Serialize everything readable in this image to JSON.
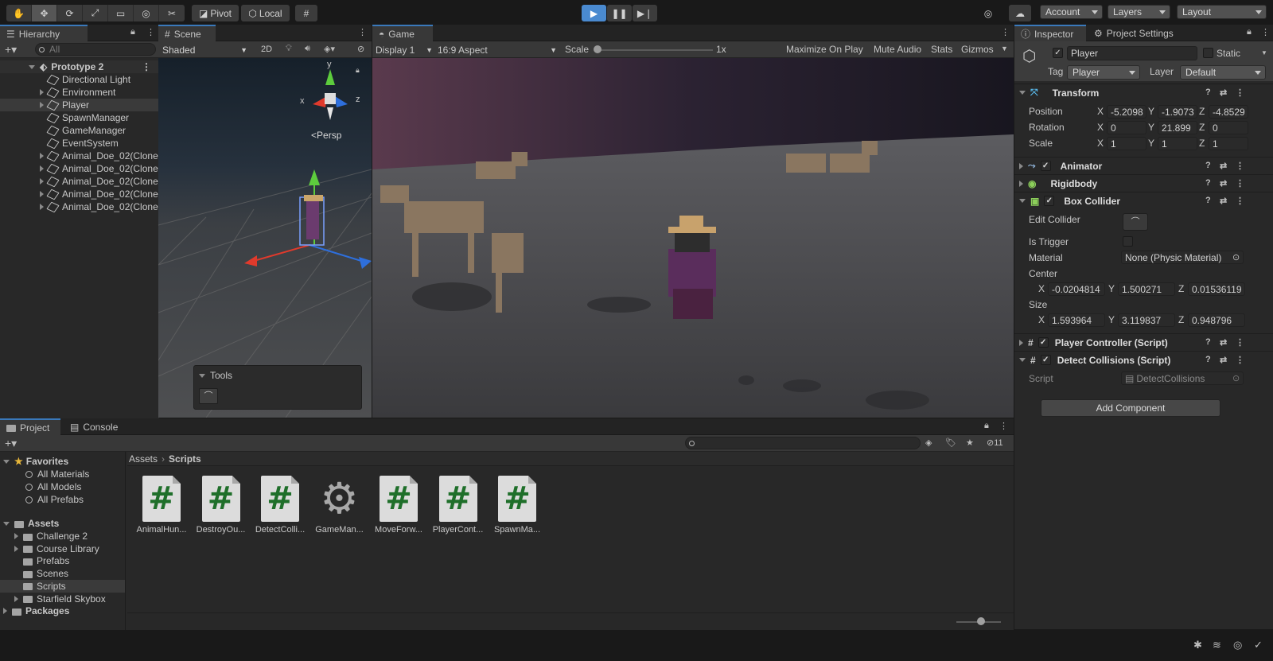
{
  "toolbar": {
    "pivot": "Pivot",
    "local": "Local",
    "account": "Account",
    "layers": "Layers",
    "layout": "Layout"
  },
  "hierarchy": {
    "tab": "Hierarchy",
    "search_placeholder": "All",
    "scene": "Prototype 2",
    "items": [
      "Directional Light",
      "Environment",
      "Player",
      "SpawnManager",
      "GameManager",
      "EventSystem",
      "Animal_Doe_02(Clone",
      "Animal_Doe_02(Clone",
      "Animal_Doe_02(Clone",
      "Animal_Doe_02(Clone",
      "Animal_Doe_02(Clone"
    ]
  },
  "scene": {
    "tab": "Scene",
    "shading": "Shaded",
    "mode_2d": "2D",
    "persp": "Persp",
    "gizmo_x": "x",
    "gizmo_y": "y",
    "gizmo_z": "z",
    "tools_title": "Tools"
  },
  "game": {
    "tab": "Game",
    "display": "Display 1",
    "aspect": "16:9 Aspect",
    "scale_label": "Scale",
    "scale_value": "1x",
    "maximize": "Maximize On Play",
    "mute": "Mute Audio",
    "stats": "Stats",
    "gizmos": "Gizmos"
  },
  "inspector": {
    "tab": "Inspector",
    "tab2": "Project Settings",
    "object_name": "Player",
    "static": "Static",
    "tag_label": "Tag",
    "tag_value": "Player",
    "layer_label": "Layer",
    "layer_value": "Default",
    "transform": {
      "title": "Transform",
      "position_label": "Position",
      "rotation_label": "Rotation",
      "scale_label": "Scale",
      "position": [
        "-5.2098",
        "-1.9073",
        "-4.8529"
      ],
      "rotation": [
        "0",
        "21.899",
        "0"
      ],
      "scale": [
        "1",
        "1",
        "1"
      ]
    },
    "axis": [
      "X",
      "Y",
      "Z"
    ],
    "animator": "Animator",
    "rigidbody": "Rigidbody",
    "box_collider": {
      "title": "Box Collider",
      "edit_collider": "Edit Collider",
      "is_trigger": "Is Trigger",
      "material_label": "Material",
      "material_value": "None (Physic Material)",
      "center_label": "Center",
      "center": [
        "-0.0204814",
        "1.500271",
        "0.01536119"
      ],
      "size_label": "Size",
      "size": [
        "1.593964",
        "3.119837",
        "0.948796"
      ]
    },
    "player_controller": "Player Controller (Script)",
    "detect_collisions": "Detect Collisions (Script)",
    "script_label": "Script",
    "script_value": "DetectCollisions",
    "add_component": "Add Component"
  },
  "project": {
    "tab": "Project",
    "tab2": "Console",
    "hidden_count": "11",
    "favorites": "Favorites",
    "favorite_items": [
      "All Materials",
      "All Models",
      "All Prefabs"
    ],
    "assets": "Assets",
    "asset_folders": [
      "Challenge 2",
      "Course Library",
      "Prefabs",
      "Scenes",
      "Scripts",
      "Starfield Skybox"
    ],
    "packages": "Packages",
    "breadcrumb_root": "Assets",
    "breadcrumb_current": "Scripts",
    "files": [
      "AnimalHun...",
      "DestroyOu...",
      "DetectColli...",
      "GameMan...",
      "MoveForw...",
      "PlayerCont...",
      "SpawnMa..."
    ]
  },
  "colors": {
    "accent": "#3a79bb",
    "play_active": "#4a8ad0"
  }
}
